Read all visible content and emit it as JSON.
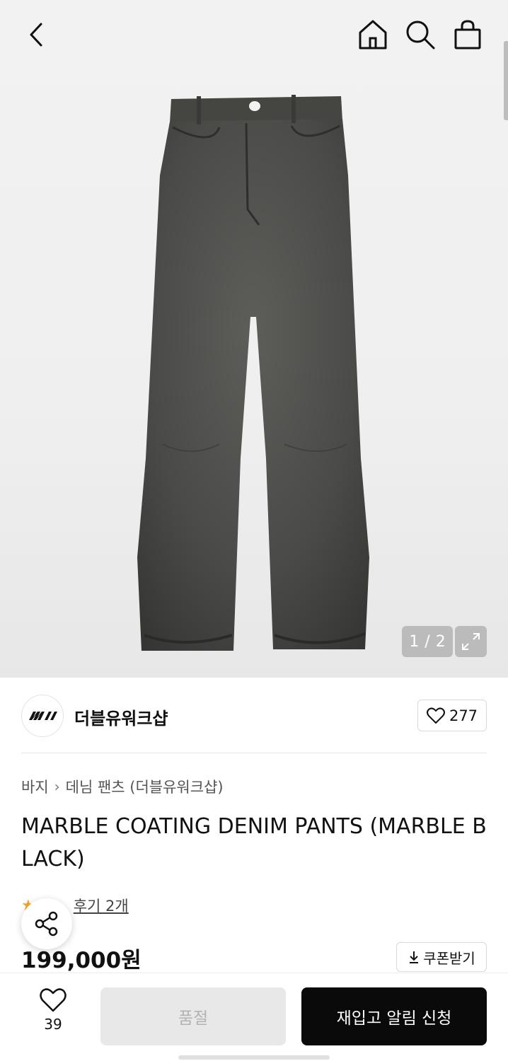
{
  "header": {
    "back_icon": "chevron-left-icon",
    "home_icon": "home-icon",
    "search_icon": "search-icon",
    "bag_icon": "shopping-bag-icon"
  },
  "gallery": {
    "current": "1",
    "separator": "/",
    "total": "2",
    "expand_icon": "expand-icon"
  },
  "brand": {
    "logo_text": "mw",
    "name": "더블유워크샵",
    "like_count": "277"
  },
  "product": {
    "breadcrumb": [
      "바지",
      "데님 팬츠 (더블유워크샵)"
    ],
    "title": "MARBLE COATING DENIM PANTS (MARBLE BLACK)",
    "review_text": "후기 2개",
    "price": "199,000원",
    "coupon_label": "쿠폰받기"
  },
  "bottom_bar": {
    "wish_count": "39",
    "soldout_label": "품절",
    "restock_label": "재입고 알림 신청"
  },
  "colors": {
    "accent_star": "#f5a623",
    "primary_button": "#0a0a0a",
    "disabled_button": "#e8e8e8"
  }
}
